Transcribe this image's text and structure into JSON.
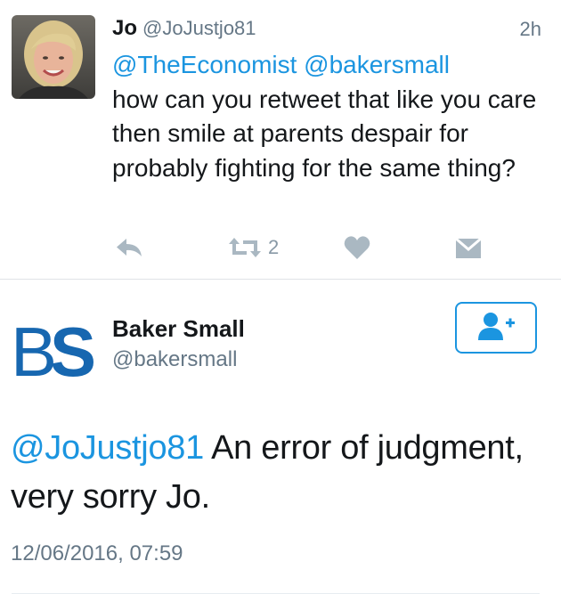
{
  "reply": {
    "display_name": "Jo",
    "screen_name": "@JoJustjo81",
    "time": "2h",
    "mentions": "@TheEconomist @bakersmall",
    "text": "how can you retweet that like you care then smile at parents despair for probably fighting for the same thing?",
    "retweet_count": "2",
    "icons": [
      "reply-icon",
      "retweet-icon",
      "like-icon",
      "direct-message-icon"
    ]
  },
  "main": {
    "author_name": "Baker Small",
    "author_handle": "@bakersmall",
    "logo_text": "BS",
    "mention": "@JoJustjo81",
    "text": " An error of judgment, very sorry Jo.",
    "date": "12/06/2016, 07:59",
    "follow_icon": "follow-user-icon"
  },
  "colors": {
    "accent": "#1b95e0",
    "logo_blue": "#1767b0",
    "secondary_text": "#657786",
    "action_gray": "#aab8c2",
    "divider": "#dfe3e6"
  }
}
